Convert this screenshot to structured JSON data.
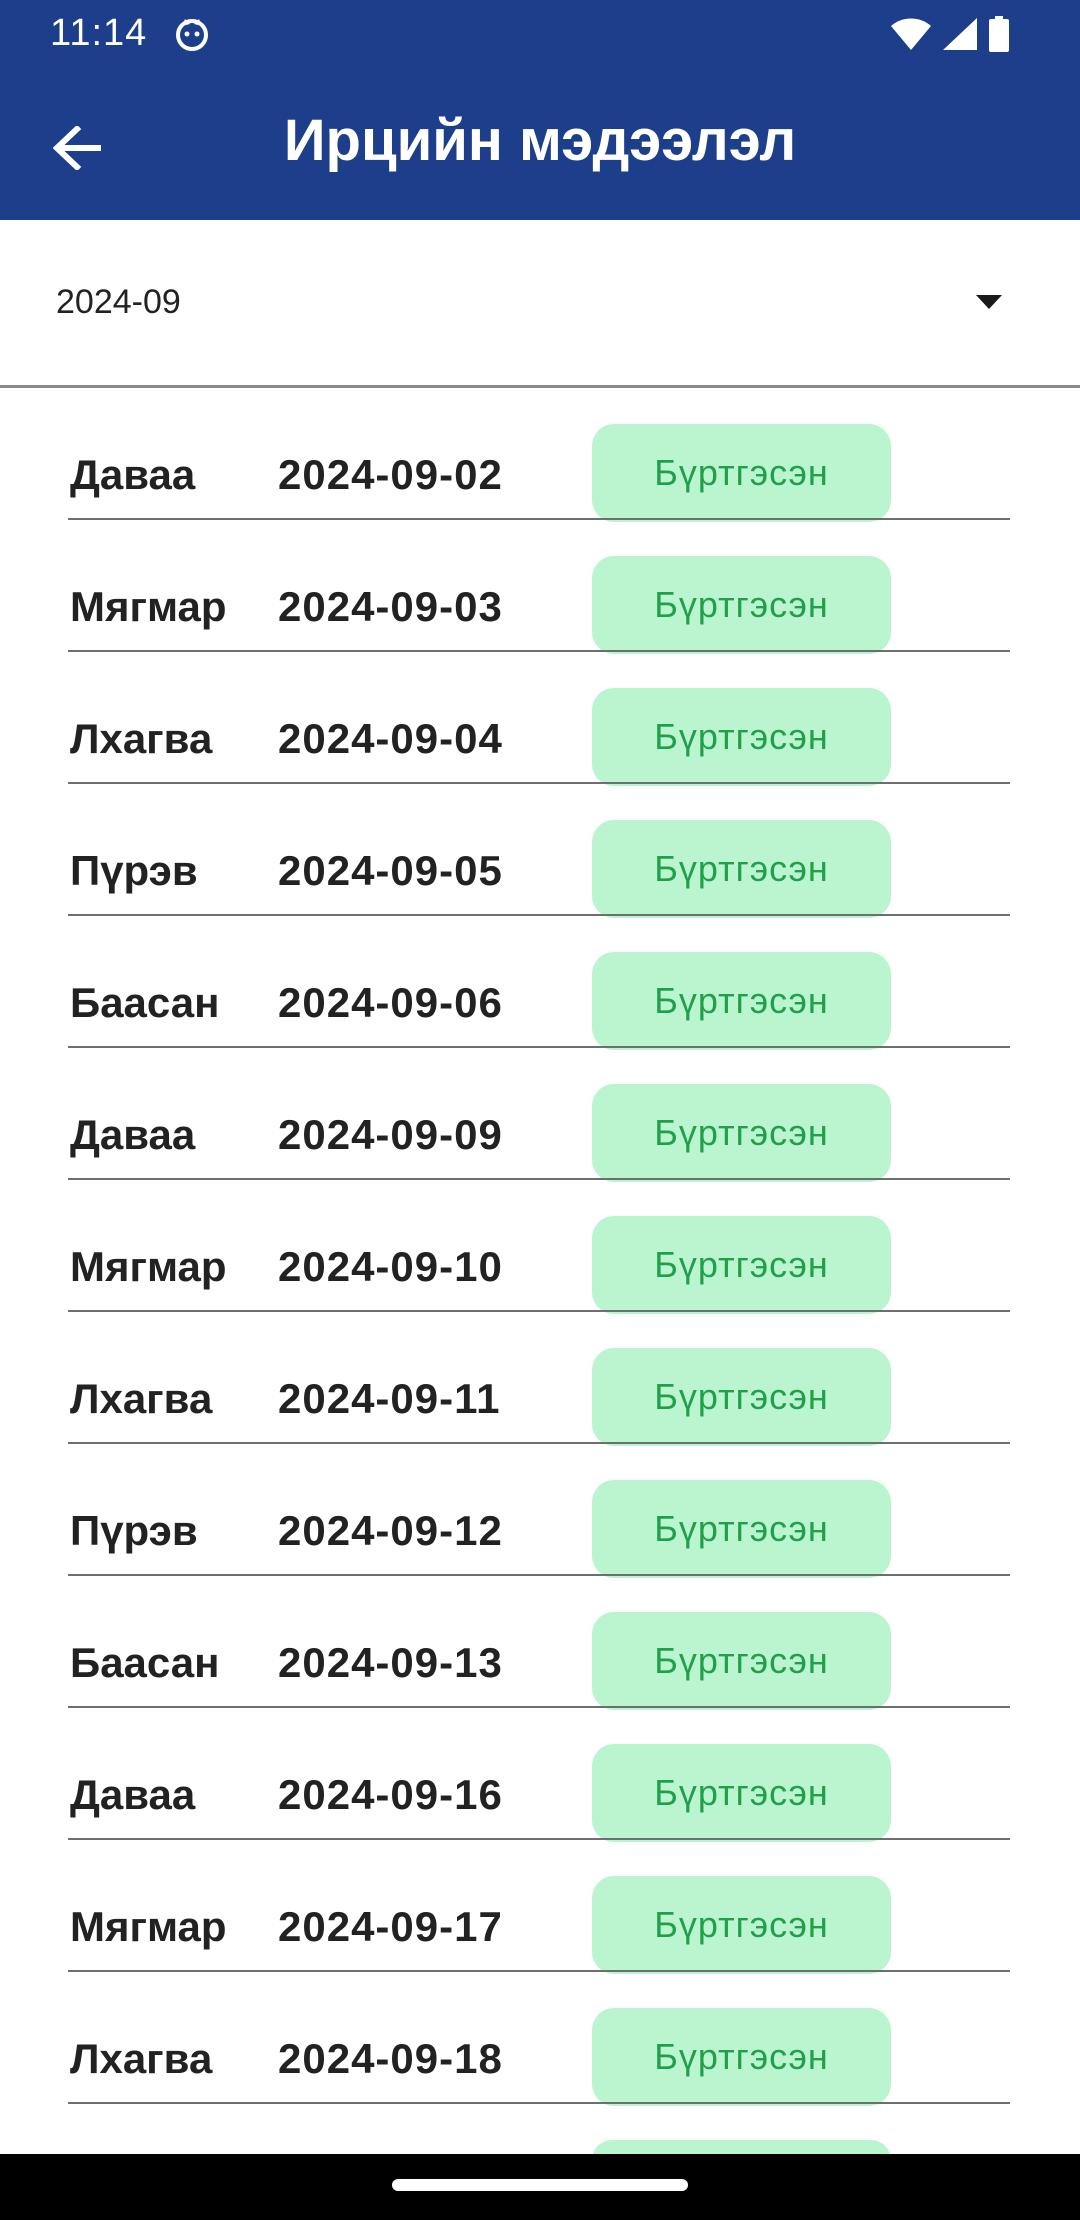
{
  "status_bar": {
    "time": "11:14"
  },
  "app_bar": {
    "title": "Ирцийн мэдээлэл",
    "back_icon": "arrow-left-icon"
  },
  "month_selector": {
    "value": "2024-09",
    "icon": "dropdown-arrow-icon"
  },
  "colors": {
    "app_bar": "#1d3f8b",
    "status_badge_bg": "#bbf5d0",
    "status_badge_text": "#20a04a"
  },
  "attendance": [
    {
      "day": "Даваа",
      "date": "2024-09-02",
      "status": "Бүртгэсэн"
    },
    {
      "day": "Мягмар",
      "date": "2024-09-03",
      "status": "Бүртгэсэн"
    },
    {
      "day": "Лхагва",
      "date": "2024-09-04",
      "status": "Бүртгэсэн"
    },
    {
      "day": "Пүрэв",
      "date": "2024-09-05",
      "status": "Бүртгэсэн"
    },
    {
      "day": "Баасан",
      "date": "2024-09-06",
      "status": "Бүртгэсэн"
    },
    {
      "day": "Даваа",
      "date": "2024-09-09",
      "status": "Бүртгэсэн"
    },
    {
      "day": "Мягмар",
      "date": "2024-09-10",
      "status": "Бүртгэсэн"
    },
    {
      "day": "Лхагва",
      "date": "2024-09-11",
      "status": "Бүртгэсэн"
    },
    {
      "day": "Пүрэв",
      "date": "2024-09-12",
      "status": "Бүртгэсэн"
    },
    {
      "day": "Баасан",
      "date": "2024-09-13",
      "status": "Бүртгэсэн"
    },
    {
      "day": "Даваа",
      "date": "2024-09-16",
      "status": "Бүртгэсэн"
    },
    {
      "day": "Мягмар",
      "date": "2024-09-17",
      "status": "Бүртгэсэн"
    },
    {
      "day": "Лхагва",
      "date": "2024-09-18",
      "status": "Бүртгэсэн"
    }
  ]
}
